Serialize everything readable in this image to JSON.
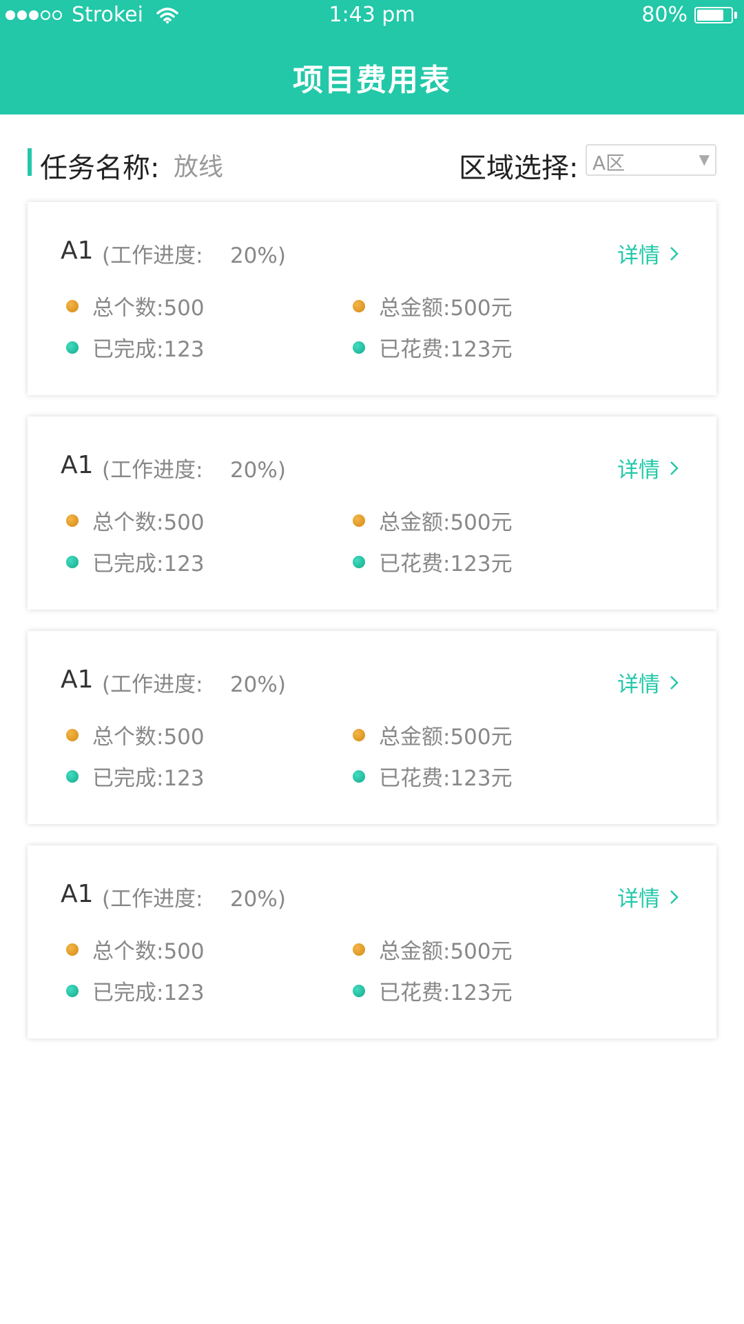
{
  "status_bar": {
    "carrier": "Strokei",
    "time": "1:43 pm",
    "battery": "80%",
    "battery_level": 0.8
  },
  "header": {
    "title": "项目费用表"
  },
  "filter": {
    "task_label": "任务名称:",
    "task_value": "放线",
    "region_label": "区域选择:",
    "region_value": "A区"
  },
  "cards": [
    {
      "name": "A1",
      "progress": "(工作进度:    20%)",
      "detail": "详情",
      "total_count": "总个数:500",
      "total_amount": "总金额:500元",
      "completed": "已完成:123",
      "spent": "已花费:123元"
    },
    {
      "name": "A1",
      "progress": "(工作进度:    20%)",
      "detail": "详情",
      "total_count": "总个数:500",
      "total_amount": "总金额:500元",
      "completed": "已完成:123",
      "spent": "已花费:123元"
    },
    {
      "name": "A1",
      "progress": "(工作进度:    20%)",
      "detail": "详情",
      "total_count": "总个数:500",
      "total_amount": "总金额:500元",
      "completed": "已完成:123",
      "spent": "已花费:123元"
    },
    {
      "name": "A1",
      "progress": "(工作进度:    20%)",
      "detail": "详情",
      "total_count": "总个数:500",
      "total_amount": "总金额:500元",
      "completed": "已完成:123",
      "spent": "已花费:123元"
    }
  ],
  "colors": {
    "accent": "#22c8a8",
    "bullet_orange": "#e6a02a",
    "bullet_teal": "#1fc0a0"
  },
  "icons": {
    "wifi": "wifi-icon",
    "battery": "battery-icon",
    "dropdown": "triangle-down-icon",
    "detail": "chevron-right-icon"
  }
}
